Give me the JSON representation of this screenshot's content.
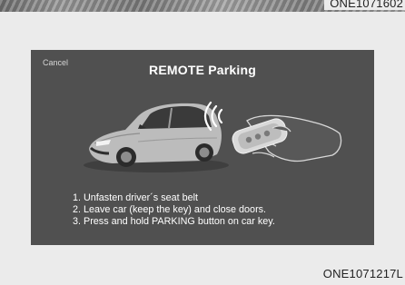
{
  "figure": {
    "top_code": "ONE1071602",
    "bottom_code": "ONE1071217L"
  },
  "screen": {
    "cancel_label": "Cancel",
    "title": "REMOTE Parking",
    "instructions": [
      "1. Unfasten driver´s seat belt",
      "2. Leave car (keep the key) and close doors.",
      "3. Press and hold PARKING button on car key."
    ]
  },
  "colors": {
    "screen_background": "#505050",
    "page_background": "#ebebeb",
    "text": "#ffffff"
  },
  "icons": [
    "car-illustration",
    "hand-holding-key-icon",
    "signal-waves-icon"
  ]
}
